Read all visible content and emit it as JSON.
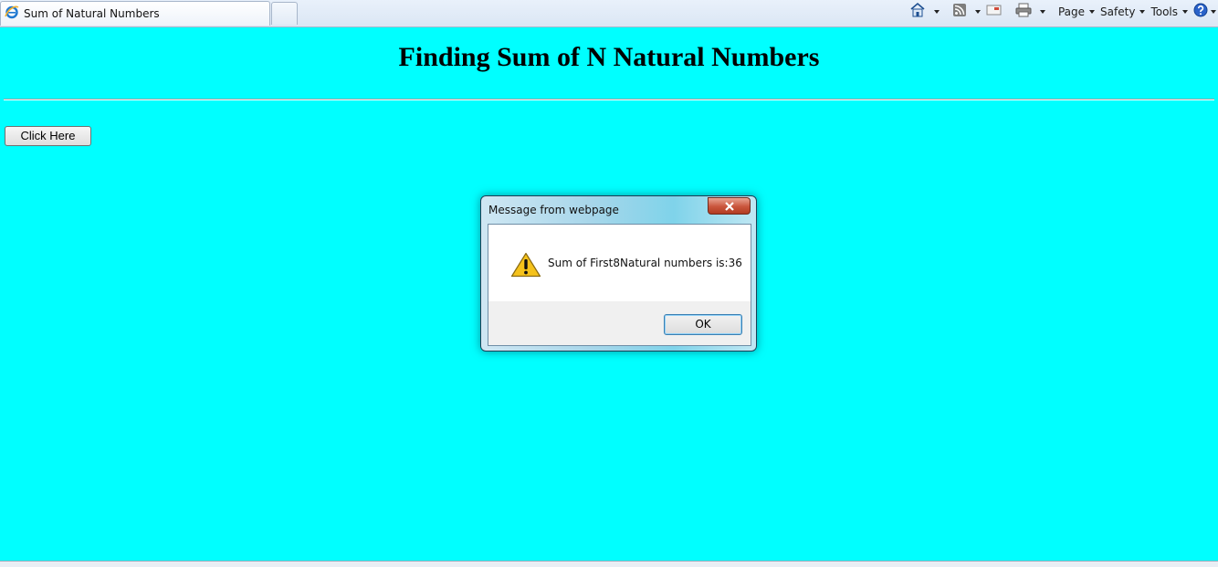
{
  "browser": {
    "tab_title": "Sum of Natural Numbers",
    "commands": {
      "page_label": "Page",
      "safety_label": "Safety",
      "tools_label": "Tools"
    },
    "icons": [
      "ie-logo-icon",
      "home-icon",
      "rss-feed-icon",
      "read-mail-icon",
      "print-icon",
      "help-icon"
    ]
  },
  "page": {
    "heading": "Finding Sum of N Natural Numbers",
    "button_label": "Click Here",
    "background_color": "#00ffff"
  },
  "dialog": {
    "title": "Message from webpage",
    "message": "Sum of First8Natural numbers is:36",
    "ok_label": "OK",
    "icon": "warning-icon"
  }
}
